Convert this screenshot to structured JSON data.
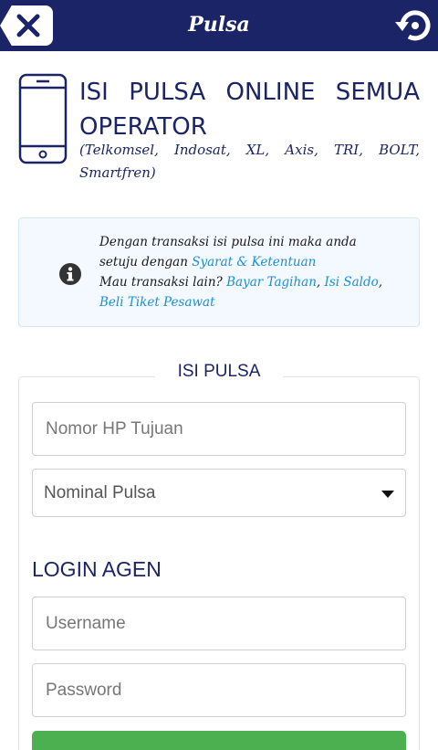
{
  "topbar": {
    "title": "Pulsa",
    "close_icon": "close-icon",
    "history_icon": "history-icon"
  },
  "header": {
    "icon": "mobile-phone-icon",
    "heading": "ISI PULSA ONLINE SEMUA OPERATOR",
    "operators": "(Telkomsel, Indosat, XL, Axis, TRI, BOLT, Smartfren)"
  },
  "info": {
    "icon": "info-icon",
    "line1": "Dengan transaksi isi pulsa ini maka anda setuju dengan ",
    "terms_link": "Syarat & Ketentuan",
    "line2": "Mau transaksi lain? ",
    "link_bills": "Bayar Tagihan",
    "sep1": ", ",
    "link_balance": "Isi Saldo",
    "sep2": ", ",
    "link_flight": "Beli Tiket Pesawat"
  },
  "form": {
    "legend": "ISI PULSA",
    "phone_placeholder": "Nomor HP Tujuan",
    "nominal_selected": "Nominal Pulsa",
    "login_heading": "LOGIN AGEN",
    "username_placeholder": "Username",
    "password_placeholder": "Password"
  },
  "colors": {
    "primary": "#1b2466",
    "link": "#1a8fd6",
    "submit": "#4caf50",
    "info_bg": "#f3f9ff"
  }
}
